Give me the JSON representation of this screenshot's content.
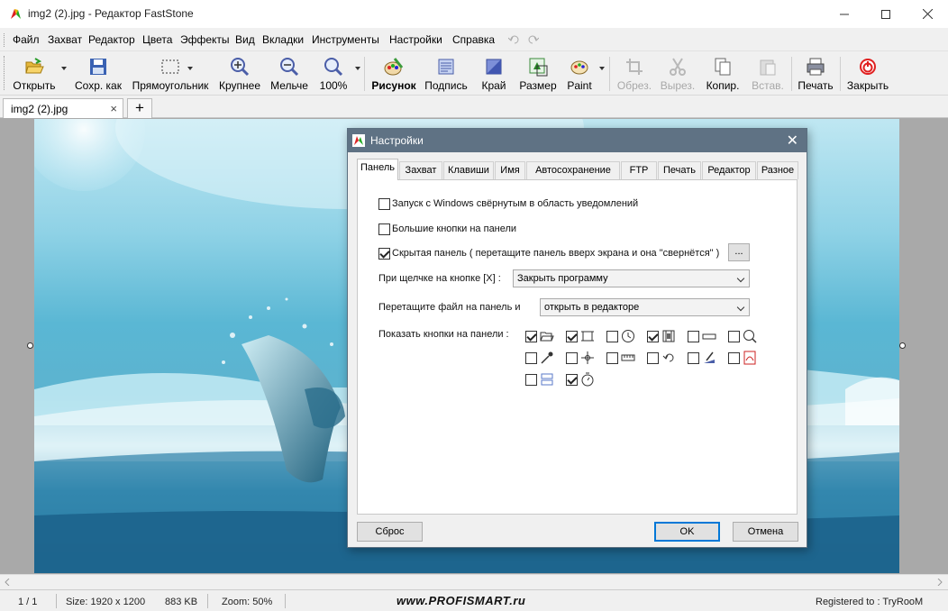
{
  "window": {
    "title": "img2 (2).jpg - Редактор FastStone",
    "minimize_icon": "minimize-icon",
    "maximize_icon": "maximize-icon",
    "close_icon": "close-icon"
  },
  "menu": [
    "Файл",
    "Захват",
    "Редактор",
    "Цвета",
    "Эффекты",
    "Вид",
    "Вкладки",
    "Инструменты",
    "Настройки",
    "Справка"
  ],
  "toolbar": {
    "open": "Открыть",
    "save_as": "Сохр. как",
    "rectangle": "Прямоугольник",
    "zoom_in": "Крупнее",
    "zoom_out": "Мельче",
    "zoom_level": "100%",
    "draw": "Рисунок",
    "caption": "Подпись",
    "edge": "Край",
    "resize": "Размер",
    "paint": "Paint",
    "crop": "Обрез.",
    "cut": "Вырез.",
    "copy": "Копир.",
    "paste": "Встав.",
    "print": "Печать",
    "close": "Закрыть"
  },
  "tabs": {
    "file_tab": "img2 (2).jpg",
    "close_glyph": "×",
    "add_glyph": "+"
  },
  "status": {
    "page": "1 / 1",
    "size": "Size: 1920 x 1200",
    "filesize": "883 KB",
    "zoom": "Zoom: 50%",
    "watermark": "www.PROFISMART.ru",
    "registered": "Registered to : TryRooM"
  },
  "dialog": {
    "title": "Настройки",
    "close_glyph": "✕",
    "tabs": [
      "Панель",
      "Захват",
      "Клавиши",
      "Имя",
      "Автосохранение",
      "FTP",
      "Печать",
      "Редактор",
      "Разное"
    ],
    "active_tab": "Панель",
    "options": {
      "start_minimized": {
        "label": "Запуск с Windows свёрнутым в область уведомлений",
        "checked": false
      },
      "big_buttons": {
        "label": "Большие кнопки на панели",
        "checked": false
      },
      "hidden_panel": {
        "label": "Скрытая панель ( перетащите панель вверх экрана и она \"свернётся\" )",
        "checked": true
      },
      "more_button": "..."
    },
    "on_x_click": {
      "label": "При щелчке на кнопке [X] :",
      "value": "Закрыть программу"
    },
    "drag_file": {
      "label": "Перетащите файл на панель и",
      "value": "открыть в редакторе"
    },
    "show_buttons_label": "Показать кнопки на панели :",
    "panel_buttons": [
      {
        "icon": "folder-open-icon",
        "checked": true
      },
      {
        "icon": "rectangle-capture-icon",
        "checked": true
      },
      {
        "icon": "clock-icon",
        "checked": false
      },
      {
        "icon": "film-icon",
        "checked": true
      },
      {
        "icon": "ruler-bar-icon",
        "checked": false
      },
      {
        "icon": "magnifier-icon",
        "checked": false
      },
      {
        "icon": "color-picker-icon",
        "checked": false
      },
      {
        "icon": "crosshair-icon",
        "checked": false
      },
      {
        "icon": "ruler-icon",
        "checked": false
      },
      {
        "icon": "undo-icon",
        "checked": false
      },
      {
        "icon": "draw-icon",
        "checked": false
      },
      {
        "icon": "pdf-icon",
        "checked": false
      },
      {
        "icon": "layout-icon",
        "checked": false
      },
      {
        "icon": "timer-icon",
        "checked": true
      }
    ],
    "reset": "Сброс",
    "ok": "OK",
    "cancel": "Отмена"
  },
  "colors": {
    "dialog_title_bg": "#5f7284",
    "canvas_bg": "#a9a9a9",
    "accent_blue": "#0078d7"
  }
}
